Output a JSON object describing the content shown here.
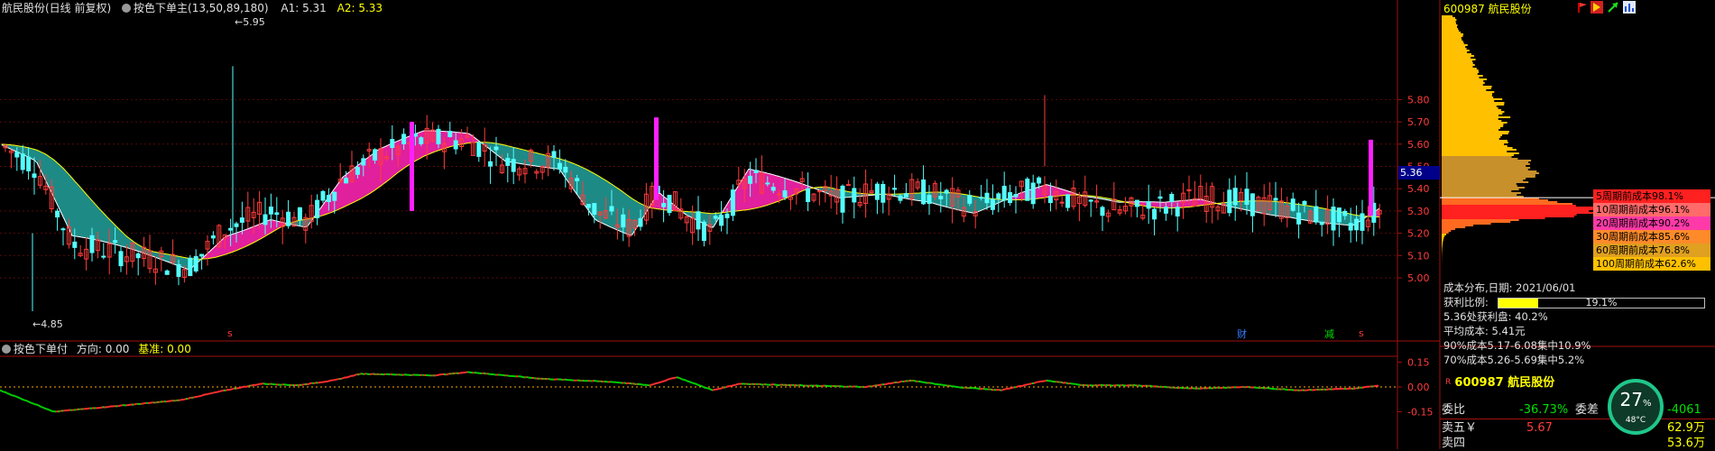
{
  "main": {
    "stock_title": "航民股份(日线 前复权)",
    "indicator_name": "按色下单主(13,50,89,180)",
    "a1_label": "A1: 5.31",
    "a2_label": "A2: 5.33",
    "high_label": "5.95",
    "low_label": "4.85",
    "price_axis": [
      "5.80",
      "5.70",
      "5.60",
      "5.50",
      "5.40",
      "5.30",
      "5.20",
      "5.10",
      "5.00"
    ],
    "current_price": "5.36",
    "markers": {
      "s1": "s",
      "cai": "财",
      "jian": "减",
      "s2": "s"
    }
  },
  "sub": {
    "indicator_name": "按色下单付",
    "direction": "方向: 0.00",
    "base": "基准: 0.00",
    "axis": [
      "0.15",
      "0.00",
      "-0.15"
    ]
  },
  "chip_panel": {
    "stock_code_name": "600987 航民股份",
    "legend": [
      {
        "label": "5周期前成本98.1%",
        "color": "#ff2020"
      },
      {
        "label": "10周期前成本96.1%",
        "color": "#ff6a6a"
      },
      {
        "label": "20周期前成本90.2%",
        "color": "#ff3aa8"
      },
      {
        "label": "30周期前成本85.6%",
        "color": "#ff8a2a"
      },
      {
        "label": "60周期前成本76.8%",
        "color": "#e0a020"
      },
      {
        "label": "100周期前成本62.6%",
        "color": "#ffc000"
      }
    ],
    "date_line": "成本分布,日期:  2021/06/01",
    "profit_label": "获利比例:",
    "profit_value": "19.1%",
    "profit_fraction": 0.191,
    "profit_at_price": "5.36处获利盘: 40.2%",
    "avg_cost": "平均成本: 5.41元",
    "cost90": "90%成本5.17-6.08集中10.9%",
    "cost70": "70%成本5.26-5.69集中5.2%"
  },
  "quote": {
    "badge": "R",
    "title": "600987 航民股份",
    "wb_label": "委比",
    "wb_value": "-36.73%",
    "wc_label": "委差",
    "wc_value": "-4061",
    "sell5_label": "卖五￥",
    "sell5_price": "5.67",
    "sell5_vol": "62.9万",
    "sell4_label": "卖四",
    "sell4_vol": "53.6万"
  },
  "gauge": {
    "value": "27",
    "unit": "%",
    "temp": "48°C"
  },
  "colors": {
    "up": "#ff3c3c",
    "down": "#54ffff",
    "magenta": "#ff20ff",
    "teal": "#1e8a86",
    "pink": "#e0209c"
  }
}
